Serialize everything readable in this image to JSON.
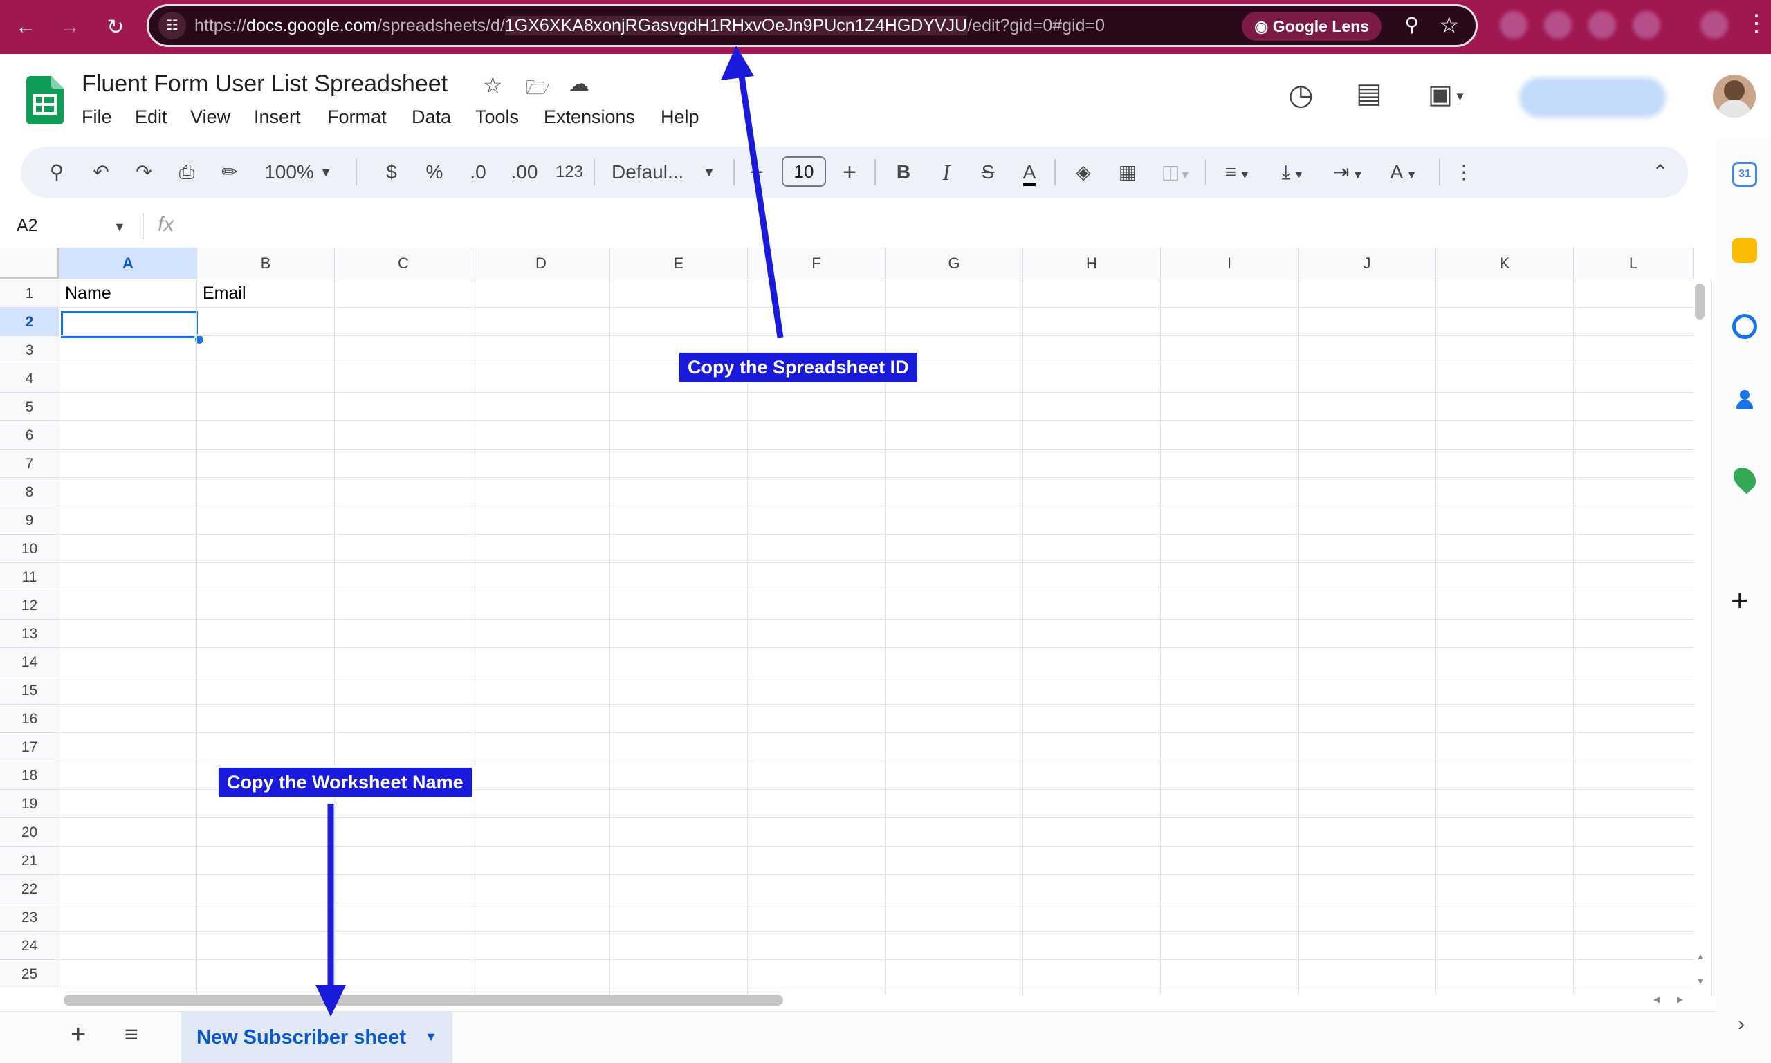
{
  "browser": {
    "url_prefix": "https://",
    "url_host": "docs.google.com",
    "url_path": "/spreadsheets/d/",
    "spreadsheet_id": "1GX6XKA8xonjRGasvgdH1RHxvOeJn9PUcn1Z4HGDYVJU",
    "url_suffix": "/edit?gid=0#gid=0",
    "lens_label": "Google Lens"
  },
  "doc": {
    "title": "Fluent Form User List Spreadsheet",
    "menu": [
      "File",
      "Edit",
      "View",
      "Insert",
      "Format",
      "Data",
      "Tools",
      "Extensions",
      "Help"
    ]
  },
  "toolbar": {
    "zoom": "100%",
    "currency": "$",
    "percent": "%",
    "dec_decrease": ".0",
    "dec_increase": ".00",
    "number_format": "123",
    "font": "Defaul...",
    "font_size": "10",
    "bold": "B",
    "italic": "I",
    "text_color": "A"
  },
  "formula_bar": {
    "name_box": "A2",
    "fx": "fx"
  },
  "grid": {
    "columns": [
      "A",
      "B",
      "C",
      "D",
      "E",
      "F",
      "G",
      "H",
      "I",
      "J",
      "K",
      "L"
    ],
    "rows": [
      "1",
      "2",
      "3",
      "4",
      "5",
      "6",
      "7",
      "8",
      "9",
      "10",
      "11",
      "12",
      "13",
      "14",
      "15",
      "16",
      "17",
      "18",
      "19",
      "20",
      "21",
      "22",
      "23",
      "24",
      "25"
    ],
    "cells": {
      "A1": "Name",
      "B1": "Email"
    },
    "selected_cell": "A2"
  },
  "sheets": {
    "active_tab": "New Subscriber sheet"
  },
  "annotations": {
    "spreadsheet_id_callout": "Copy the Spreadsheet ID",
    "worksheet_name_callout": "Copy the Worksheet Name",
    "color": "#1a1adb"
  },
  "side_panel": {
    "calendar_day": "31"
  }
}
